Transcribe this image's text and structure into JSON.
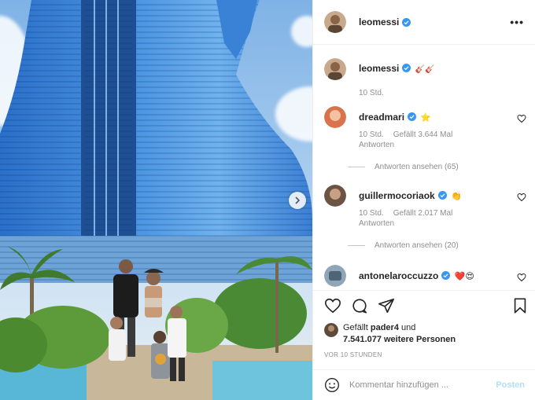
{
  "post": {
    "author": "leomessi",
    "more_label": "•••"
  },
  "caption": {
    "author": "leomessi",
    "emoji": "🎸🎸",
    "age": "10 Std."
  },
  "comments": [
    {
      "user": "dreadmari",
      "emoji": "⭐",
      "age": "10 Std.",
      "likes": "Gefällt 3.644 Mal",
      "reply_label": "Antworten",
      "view_replies": "Antworten ansehen (65)"
    },
    {
      "user": "guillermocoriaok",
      "emoji": "👏",
      "age": "10 Std.",
      "likes": "Gefällt 2.017 Mal",
      "reply_label": "Antworten",
      "view_replies": "Antworten ansehen (20)"
    },
    {
      "user": "antonelaroccuzzo",
      "emoji": "❤️😍"
    }
  ],
  "likes": {
    "prefix": "Gefällt ",
    "first_user": "pader4",
    "connector": " und",
    "count": "7.541.077 weitere Personen"
  },
  "timestamp": "VOR 10 STUNDEN",
  "composer": {
    "placeholder": "Kommentar hinzufügen ...",
    "post_label": "Posten"
  },
  "icons": {
    "like": "heart-icon",
    "comment": "comment-icon",
    "share": "share-icon",
    "save": "bookmark-icon",
    "emoji": "smiley-icon",
    "next": "chevron-right-icon",
    "verified": "verified-badge-icon"
  },
  "colors": {
    "verified": "#3897f0",
    "muted": "#8e8e8e",
    "post_button": "#b2dffc",
    "heart_red": "#ed4956"
  }
}
